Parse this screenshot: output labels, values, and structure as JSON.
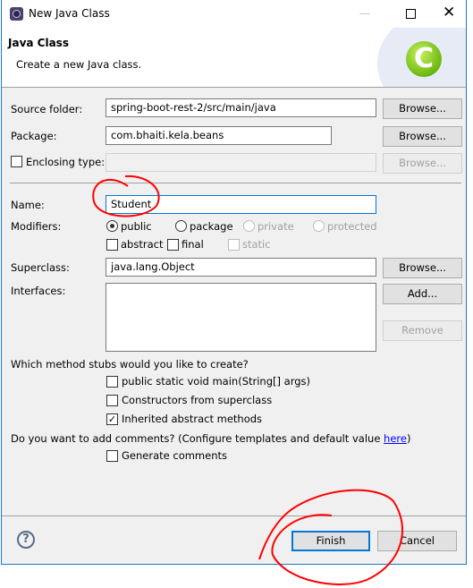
{
  "window": {
    "title": "New Java Class"
  },
  "header": {
    "title": "Java Class",
    "subtitle": "Create a new Java class."
  },
  "form": {
    "source_folder": {
      "label": "Source folder:",
      "value": "spring-boot-rest-2/src/main/java",
      "browse": "Browse..."
    },
    "package": {
      "label": "Package:",
      "value": "com.bhaiti.kela.beans",
      "browse": "Browse..."
    },
    "enclosing": {
      "label": "Enclosing type:",
      "value": "",
      "browse": "Browse...",
      "checked": false
    },
    "name": {
      "label": "Name:",
      "value": "Student"
    },
    "modifiers": {
      "label": "Modifiers:",
      "radios": [
        {
          "label": "public",
          "selected": true,
          "enabled": true
        },
        {
          "label": "package",
          "selected": false,
          "enabled": true
        },
        {
          "label": "private",
          "selected": false,
          "enabled": false
        },
        {
          "label": "protected",
          "selected": false,
          "enabled": false
        }
      ],
      "checks": [
        {
          "label": "abstract",
          "checked": false,
          "enabled": true
        },
        {
          "label": "final",
          "checked": false,
          "enabled": true
        },
        {
          "label": "static",
          "checked": false,
          "enabled": false
        }
      ]
    },
    "superclass": {
      "label": "Superclass:",
      "value": "java.lang.Object",
      "browse": "Browse..."
    },
    "interfaces": {
      "label": "Interfaces:",
      "add": "Add...",
      "remove": "Remove"
    },
    "stubs": {
      "question": "Which method stubs would you like to create?",
      "options": [
        {
          "label": "public static void main(String[] args)",
          "checked": false
        },
        {
          "label": "Constructors from superclass",
          "checked": false
        },
        {
          "label": "Inherited abstract methods",
          "checked": true
        }
      ]
    },
    "comments": {
      "question": "Do you want to add comments? (Configure templates and default value ",
      "link": "here",
      "question_end": ")",
      "option": "Generate comments",
      "checked": false
    }
  },
  "footer": {
    "finish": "Finish",
    "cancel": "Cancel"
  },
  "colors": {
    "accent": "#0078d7",
    "annotation": "#ff0000",
    "link": "#0000ff"
  }
}
